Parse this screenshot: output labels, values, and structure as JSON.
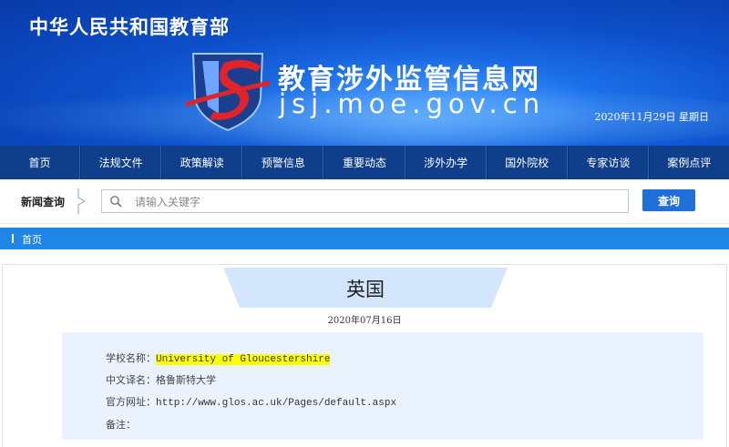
{
  "header": {
    "ministry": "中华人民共和国教育部",
    "site_title": "教育涉外监管信息网",
    "site_domain": "jsj.moe.gov.cn",
    "date_line": "2020年11月29日  星期日",
    "colors": {
      "banner": "#0d4fc9",
      "nav": "#0f3e8a",
      "accent": "#1e6fd9",
      "logo_red": "#e0242a"
    }
  },
  "nav": {
    "items": [
      {
        "label": "首页"
      },
      {
        "label": "法规文件"
      },
      {
        "label": "政策解读"
      },
      {
        "label": "预警信息"
      },
      {
        "label": "重要动态"
      },
      {
        "label": "涉外办学"
      },
      {
        "label": "国外院校"
      },
      {
        "label": "专家访谈"
      },
      {
        "label": "案例点评"
      }
    ]
  },
  "search": {
    "label": "新闻查询",
    "placeholder": "请输入关键字",
    "button": "查询",
    "icon": "search-icon"
  },
  "breadcrumb": {
    "home": "首页"
  },
  "article": {
    "country": "英国",
    "date": "2020年07月16日",
    "fields": {
      "school_name_label": "学校名称：",
      "school_name_value": "University of Gloucestershire",
      "cn_name_label": "中文译名：",
      "cn_name_value": "格鲁斯特大学",
      "website_label": "官方网址：",
      "website_value": "http://www.glos.ac.uk/Pages/default.aspx",
      "note_label": "备注："
    }
  }
}
